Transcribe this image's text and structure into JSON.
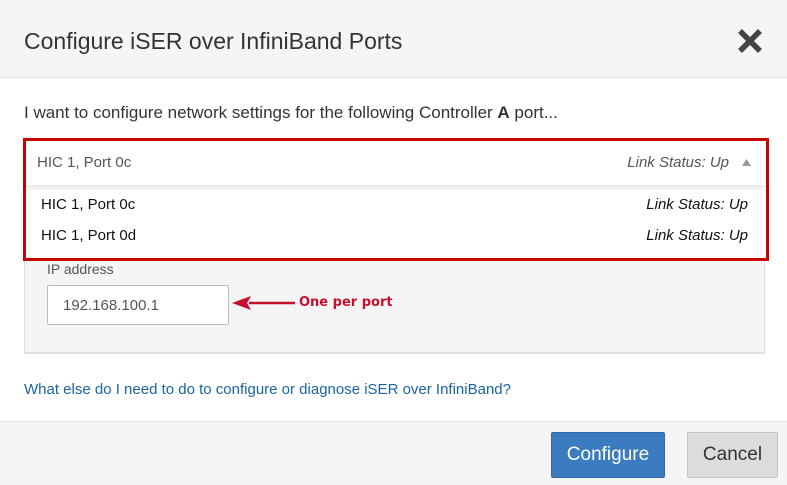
{
  "dialog": {
    "title": "Configure iSER over InfiniBand Ports"
  },
  "intro": {
    "prefix": "I want to configure network settings for the following Controller ",
    "controller": "A",
    "suffix": " port..."
  },
  "port_dropdown": {
    "selected": {
      "port": "HIC 1, Port 0c",
      "status": "Link Status: Up"
    },
    "options": [
      {
        "port": "HIC 1, Port 0c",
        "status": "Link Status: Up"
      },
      {
        "port": "HIC 1, Port 0d",
        "status": "Link Status: Up"
      }
    ]
  },
  "ip_field": {
    "label": "IP address",
    "value": "192.168.100.1"
  },
  "annotation": {
    "text": "One per port",
    "color": "#c8102e"
  },
  "help_link": {
    "text": "What else do I need to do to configure or diagnose iSER over InfiniBand?"
  },
  "footer": {
    "configure_label": "Configure",
    "cancel_label": "Cancel"
  },
  "colors": {
    "primary_button": "#3a7cbf",
    "highlight_border": "#cc0000",
    "link": "#1a64a8"
  },
  "icons": {
    "close": "close-icon",
    "caret": "caret-up-icon",
    "arrow": "arrow-left-icon"
  }
}
